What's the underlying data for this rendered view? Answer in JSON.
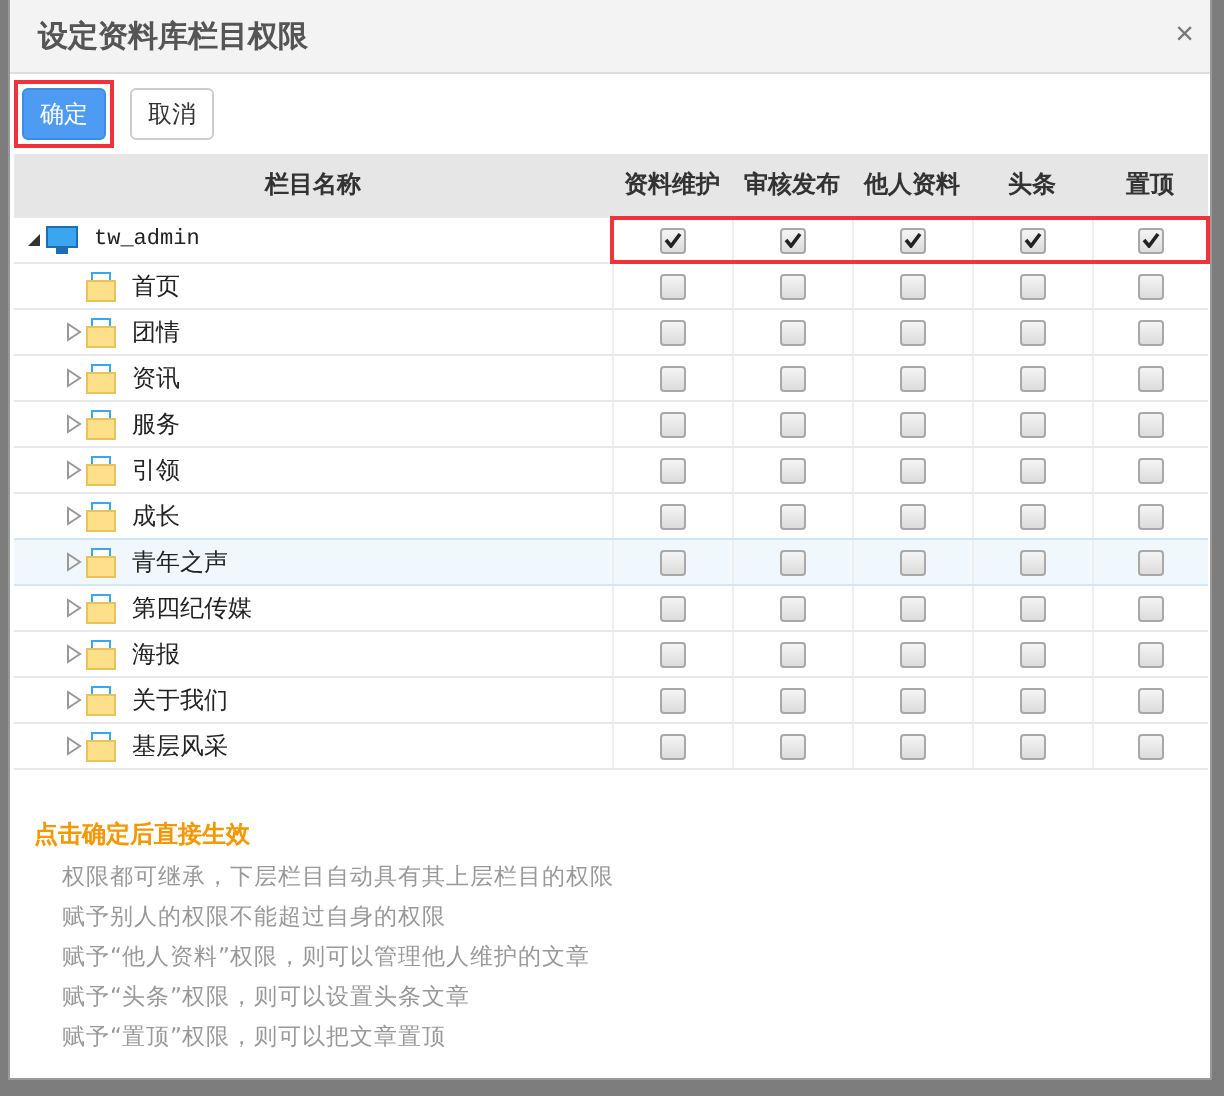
{
  "dialog": {
    "title": "设定资料库栏目权限",
    "close": "×"
  },
  "toolbar": [
    {
      "label": "确定",
      "kind": "primary",
      "marked": true
    },
    {
      "label": "取消",
      "kind": "default",
      "marked": false
    }
  ],
  "table": {
    "columns": [
      "栏目名称",
      "资料维护",
      "审核发布",
      "他人资料",
      "头条",
      "置顶"
    ],
    "rows": [
      {
        "name": "tw_admin",
        "kind": "root",
        "expanded": true,
        "marked": true,
        "highlighted": false,
        "checks": [
          true,
          true,
          true,
          true,
          true
        ],
        "children": [
          {
            "name": "首页",
            "kind": "leaf",
            "marked": false,
            "highlighted": false,
            "checks": [
              false,
              false,
              false,
              false,
              false
            ]
          },
          {
            "name": "团情",
            "kind": "branch",
            "expanded": false,
            "marked": false,
            "highlighted": false,
            "checks": [
              false,
              false,
              false,
              false,
              false
            ]
          },
          {
            "name": "资讯",
            "kind": "branch",
            "expanded": false,
            "marked": false,
            "highlighted": false,
            "checks": [
              false,
              false,
              false,
              false,
              false
            ]
          },
          {
            "name": "服务",
            "kind": "branch",
            "expanded": false,
            "marked": false,
            "highlighted": false,
            "checks": [
              false,
              false,
              false,
              false,
              false
            ]
          },
          {
            "name": "引领",
            "kind": "branch",
            "expanded": false,
            "marked": false,
            "highlighted": false,
            "checks": [
              false,
              false,
              false,
              false,
              false
            ]
          },
          {
            "name": "成长",
            "kind": "branch",
            "expanded": false,
            "marked": false,
            "highlighted": false,
            "checks": [
              false,
              false,
              false,
              false,
              false
            ]
          },
          {
            "name": "青年之声",
            "kind": "branch",
            "expanded": false,
            "marked": false,
            "highlighted": true,
            "checks": [
              false,
              false,
              false,
              false,
              false
            ]
          },
          {
            "name": "第四纪传媒",
            "kind": "branch",
            "expanded": false,
            "marked": false,
            "highlighted": false,
            "checks": [
              false,
              false,
              false,
              false,
              false
            ]
          },
          {
            "name": "海报",
            "kind": "branch",
            "expanded": false,
            "marked": false,
            "highlighted": false,
            "checks": [
              false,
              false,
              false,
              false,
              false
            ]
          },
          {
            "name": "关于我们",
            "kind": "branch",
            "expanded": false,
            "marked": false,
            "highlighted": false,
            "checks": [
              false,
              false,
              false,
              false,
              false
            ]
          },
          {
            "name": "基层风采",
            "kind": "branch",
            "expanded": false,
            "marked": false,
            "highlighted": false,
            "checks": [
              false,
              false,
              false,
              false,
              false
            ]
          }
        ]
      }
    ]
  },
  "notes": {
    "heading": "点击确定后直接生效",
    "lines": [
      "权限都可继承，下层栏目自动具有其上层栏目的权限",
      "赋予别人的权限不能超过自身的权限",
      "赋予“他人资料”权限，则可以管理他人维护的文章",
      "赋予“头条”权限，则可以设置头条文章",
      "赋予“置顶”权限，则可以把文章置顶"
    ]
  }
}
